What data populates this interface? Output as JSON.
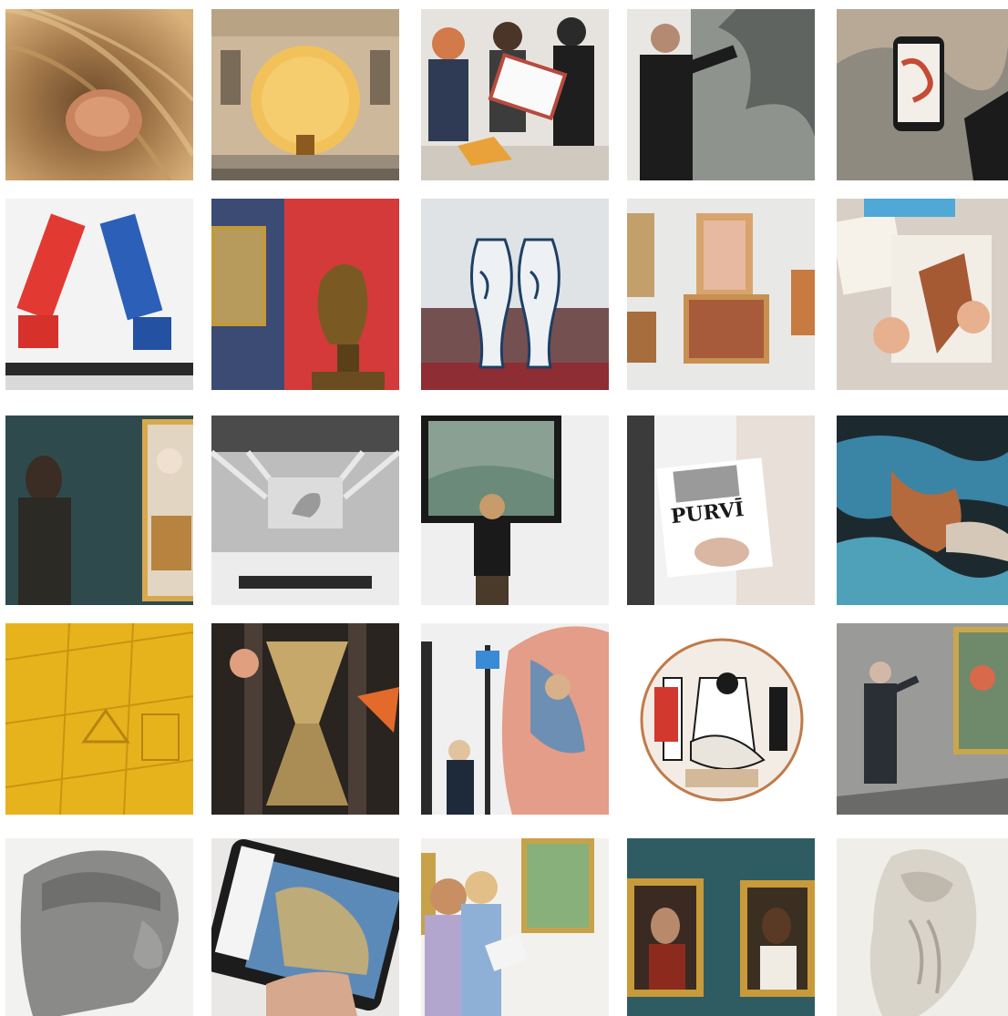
{
  "gallery": {
    "tiles": [
      {
        "id": "nest-sculpture",
        "accent": "#c88a5a"
      },
      {
        "id": "museum-facade-golden-sphere",
        "accent": "#f2c15a"
      },
      {
        "id": "workshop-group",
        "accent": "#c9674e"
      },
      {
        "id": "speaker-gesturing",
        "accent": "#2a2a2a"
      },
      {
        "id": "phone-artwork",
        "accent": "#d66d4e"
      },
      {
        "id": "red-blue-blocks-sculpture",
        "accent": "#2b5fb8"
      },
      {
        "id": "bronze-bust-red-wall",
        "accent": "#d43a3a"
      },
      {
        "id": "twin-vases-display",
        "accent": "#1e3f66"
      },
      {
        "id": "salon-hang-portraits",
        "accent": "#cfa15e"
      },
      {
        "id": "children-drawing",
        "accent": "#a55a34"
      },
      {
        "id": "woman-viewing-portrait",
        "accent": "#2f4a4d"
      },
      {
        "id": "projection-hand-hall",
        "accent": "#8f8f8f"
      },
      {
        "id": "girl-viewing-landscape",
        "accent": "#6b8a79"
      },
      {
        "id": "purvitis-brochure",
        "accent": "#f2f2f2",
        "caption": "PURVĪ"
      },
      {
        "id": "tapestry-detail",
        "accent": "#b46a3c"
      },
      {
        "id": "yellow-relief",
        "accent": "#e7b31c"
      },
      {
        "id": "geometric-sculpture-hall",
        "accent": "#c5a86a"
      },
      {
        "id": "child-photographing-mural",
        "accent": "#e39d88"
      },
      {
        "id": "round-illustration",
        "accent": "#c24a3c"
      },
      {
        "id": "man-presenting-painting",
        "accent": "#4a4a4a"
      },
      {
        "id": "stone-head-sculpture",
        "accent": "#8a8a8a"
      },
      {
        "id": "tablet-app-painting",
        "accent": "#5c8ab8"
      },
      {
        "id": "girls-with-guide",
        "accent": "#e7d2b0"
      },
      {
        "id": "framed-portraits-teal",
        "accent": "#2f5c63"
      },
      {
        "id": "moses-marble",
        "accent": "#e6e2da"
      }
    ]
  }
}
